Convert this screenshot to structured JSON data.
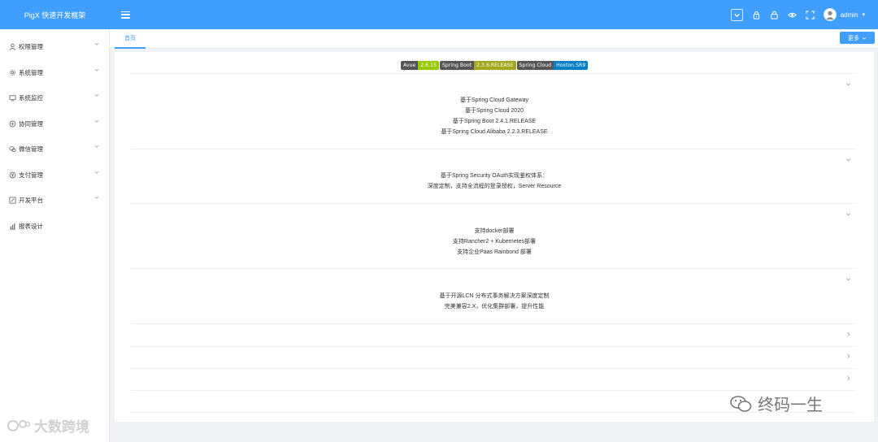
{
  "header": {
    "logo": "PigX 快速开发框架",
    "user_name": "admin",
    "icons": [
      "menu-icon",
      "select-icon",
      "lock-icon",
      "lock-icon",
      "eye-icon",
      "fullscreen-icon"
    ],
    "colors": {
      "primary": "#409eff"
    }
  },
  "sidebar": {
    "items": [
      {
        "label": "权限管理",
        "icon": "user-icon",
        "has_arrow": true
      },
      {
        "label": "系统管理",
        "icon": "gear-icon",
        "has_arrow": true
      },
      {
        "label": "系统监控",
        "icon": "monitor-icon",
        "has_arrow": true
      },
      {
        "label": "协同管理",
        "icon": "cooperate-icon",
        "has_arrow": true
      },
      {
        "label": "微信管理",
        "icon": "wechat-icon",
        "has_arrow": true
      },
      {
        "label": "支付管理",
        "icon": "pay-icon",
        "has_arrow": true
      },
      {
        "label": "开发平台",
        "icon": "dev-icon",
        "has_arrow": true
      },
      {
        "label": "报表设计",
        "icon": "chart-icon",
        "has_arrow": false
      }
    ]
  },
  "tabs": {
    "home": "首页",
    "more": "更多"
  },
  "badges": [
    {
      "left": "Avue",
      "right": "2.6.15",
      "right_color": "#97ca00"
    },
    {
      "left": "Spring Boot",
      "right": "2.3.6.RELEASE",
      "right_color": "#a4a61d"
    },
    {
      "left": "Spring Cloud",
      "right": "Hoxton.SR9",
      "right_color": "#007ec6"
    }
  ],
  "blocks": [
    {
      "lines": [
        "基于Spring Cloud Gateway",
        "基于Spring Cloud 2020",
        "基于Spring Boot 2.4.1.RELEASE",
        "基于Spring Cloud Alibaba 2.2.3.RELEASE"
      ]
    },
    {
      "lines": [
        "基于Spring Security OAuth实现鉴权体系：",
        "深度定制，支持全流程的登录授权，Server Resource"
      ]
    },
    {
      "lines": [
        "支持docker部署",
        "支持Rancher2 + Kubernetes部署",
        "支持企业Paas Rainbond 部署"
      ]
    },
    {
      "lines": [
        "基于开源LCN 分布式事务解决方案深度定制",
        "完美兼容2.X，优化集群部署，提升性能"
      ]
    }
  ],
  "watermarks": {
    "left": "大数跨境",
    "right": "终码一生"
  }
}
